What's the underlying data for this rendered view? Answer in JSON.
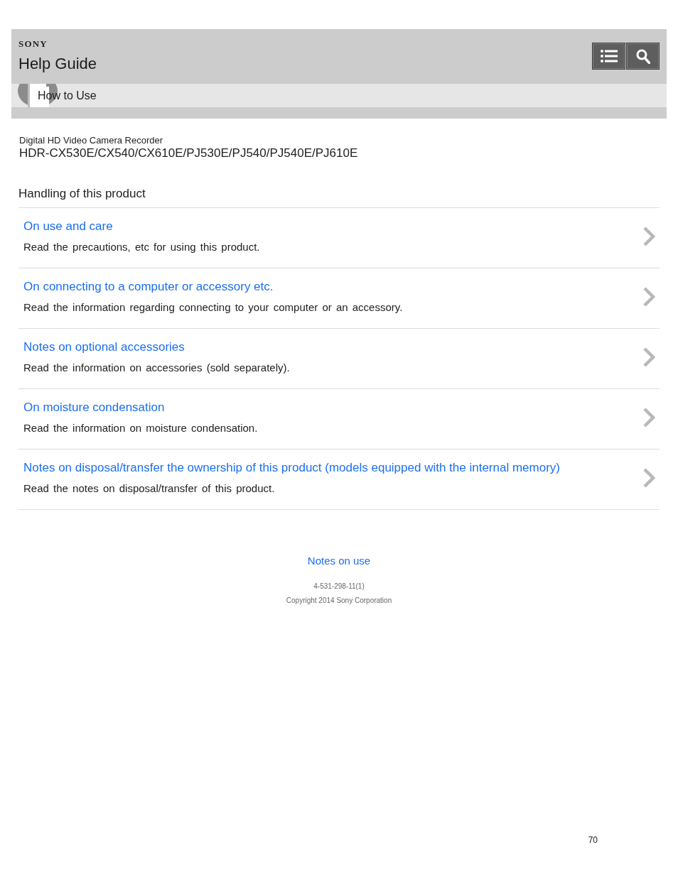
{
  "header": {
    "brand": "SONY",
    "title": "Help Guide"
  },
  "breadcrumb": {
    "label": "How to Use"
  },
  "product": {
    "category": "Digital HD Video Camera Recorder",
    "models": "HDR-CX530E/CX540/CX610E/PJ530E/PJ540/PJ540E/PJ610E"
  },
  "section": {
    "heading": "Handling of this product",
    "items": [
      {
        "title": "On use and care",
        "description": "Read the precautions, etc for using this product."
      },
      {
        "title": "On connecting to a computer or accessory etc.",
        "description": "Read the information regarding connecting to your computer or an accessory."
      },
      {
        "title": "Notes on optional accessories",
        "description": "Read the information on accessories (sold separately)."
      },
      {
        "title": "On moisture condensation",
        "description": "Read the information on moisture condensation."
      },
      {
        "title": "Notes on disposal/transfer the ownership of this product (models equipped with the internal memory)",
        "description": "Read the notes on disposal/transfer of this product."
      }
    ]
  },
  "footer": {
    "link": "Notes on use",
    "code": "4-531-298-11(1)",
    "copyright": "Copyright 2014 Sony Corporation"
  },
  "page_number": "70"
}
